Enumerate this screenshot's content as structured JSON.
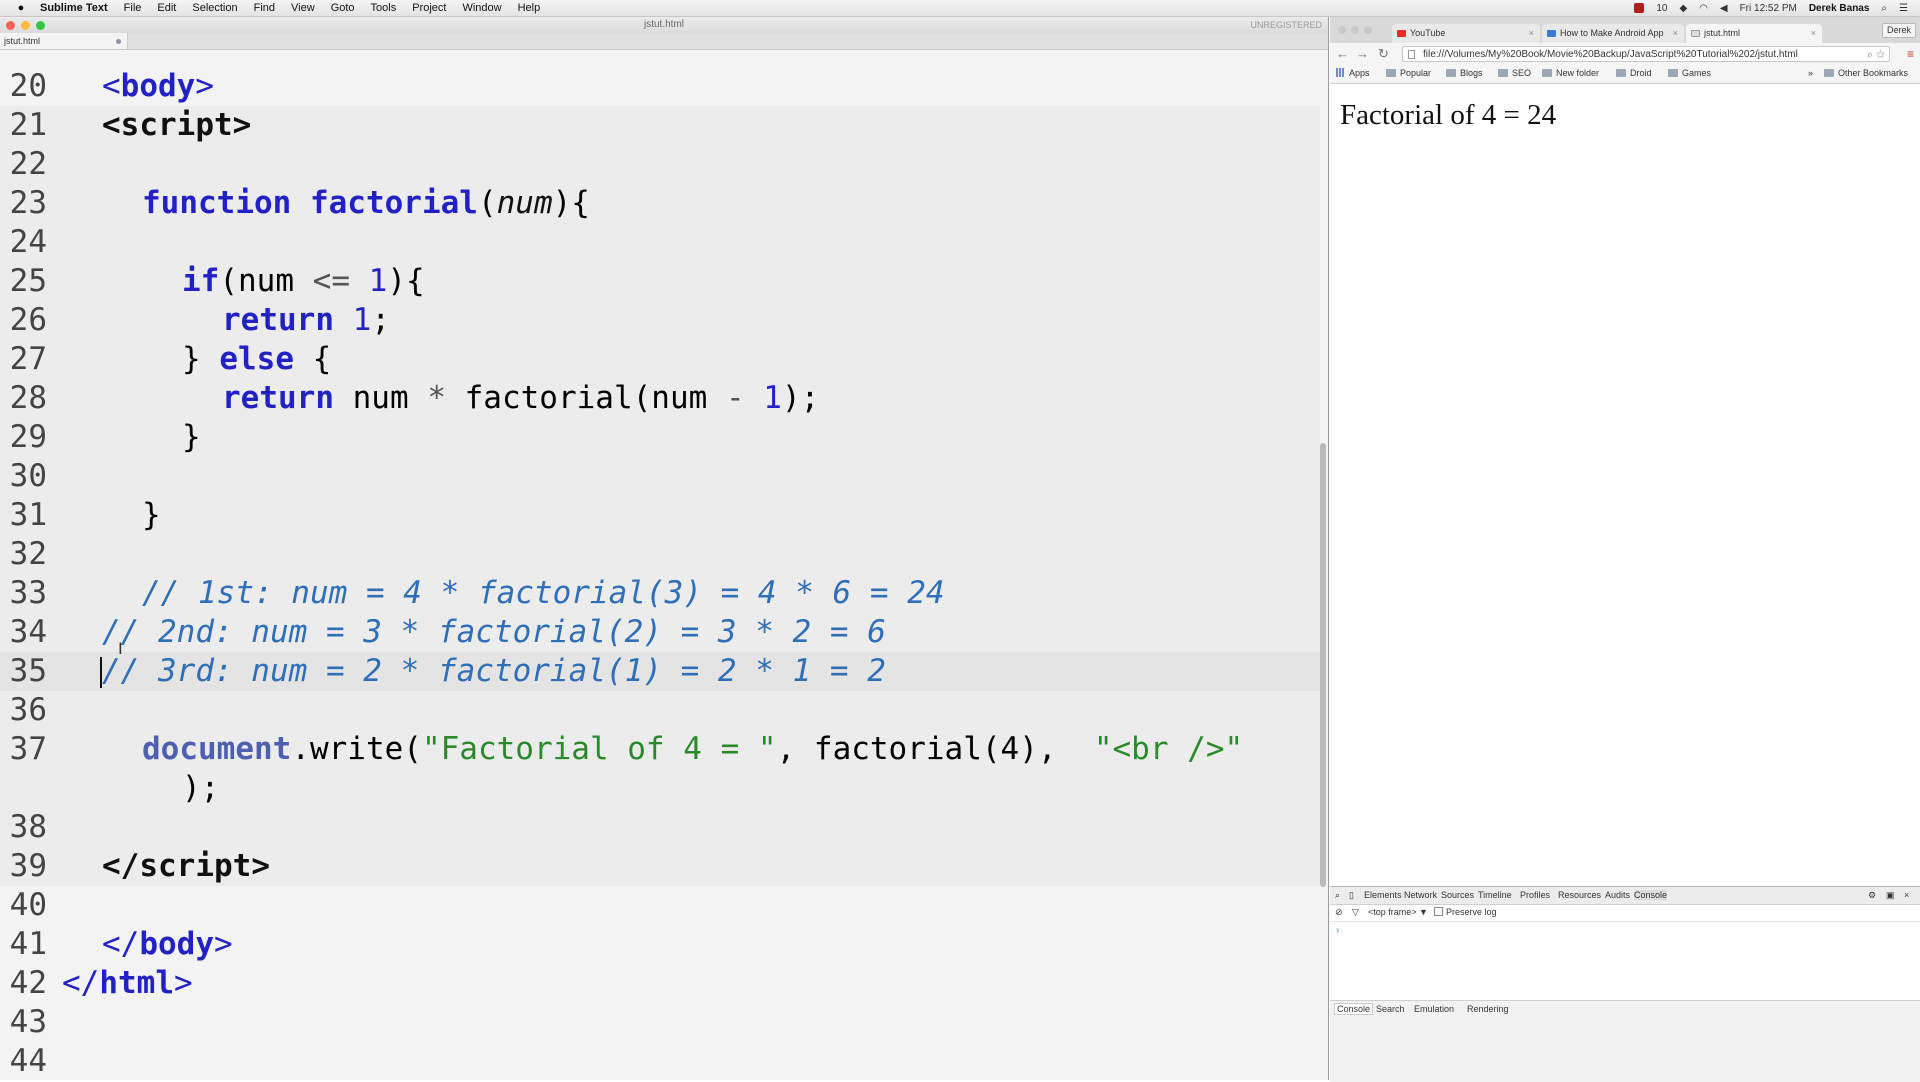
{
  "menubar": {
    "apple": "",
    "app_name": "Sublime Text",
    "items": [
      "File",
      "Edit",
      "Selection",
      "Find",
      "View",
      "Goto",
      "Tools",
      "Project",
      "Window",
      "Help"
    ],
    "tray_count": "10",
    "clock": "Fri 12:52 PM",
    "user": "Derek Banas"
  },
  "editor": {
    "window_title": "jstut.html",
    "unregistered": "UNREGISTERED",
    "tab_label": "jstut.html",
    "lines": [
      {
        "n": "20"
      },
      {
        "n": "21"
      },
      {
        "n": "22"
      },
      {
        "n": "23"
      },
      {
        "n": "24"
      },
      {
        "n": "25"
      },
      {
        "n": "26"
      },
      {
        "n": "27"
      },
      {
        "n": "28"
      },
      {
        "n": "29"
      },
      {
        "n": "30"
      },
      {
        "n": "31"
      },
      {
        "n": "32"
      },
      {
        "n": "33"
      },
      {
        "n": "34"
      },
      {
        "n": "35"
      },
      {
        "n": "36"
      },
      {
        "n": "37"
      },
      {
        "n": "38"
      },
      {
        "n": "39"
      },
      {
        "n": "40"
      },
      {
        "n": "41"
      },
      {
        "n": "42"
      },
      {
        "n": "43"
      },
      {
        "n": "44"
      }
    ],
    "code": {
      "l20_open": "<",
      "l20_tag": "body",
      "l20_close": ">",
      "l21_open": "<",
      "l21_tag": "script",
      "l21_close": ">",
      "l23_kw": "function",
      "l23_name": " factorial",
      "l23_paren_open": "(",
      "l23_arg": "num",
      "l23_paren_close": "){",
      "l25_kw": "if",
      "l25_rest_a": "(num ",
      "l25_op": "<=",
      "l25_sp": " ",
      "l25_num": "1",
      "l25_rest_b": "){",
      "l26_kw": "return",
      "l26_sp": " ",
      "l26_num": "1",
      "l26_end": ";",
      "l27_brace": "} ",
      "l27_kw": "else",
      "l27_end": " {",
      "l28_kw": "return",
      "l28_a": " num ",
      "l28_op1": "*",
      "l28_b": " factorial(num ",
      "l28_op2": "-",
      "l28_sp": " ",
      "l28_num": "1",
      "l28_end": ");",
      "l29": "}",
      "l31": "}",
      "l33": "// 1st: num = 4 * factorial(3) = 4 * 6 = 24",
      "l34": "// 2nd: num = 3 * factorial(2) = 3 * 2 = 6",
      "l35": "// 3rd: num = 2 * factorial(1) = 2 * 1 = 2",
      "l37_obj": "document",
      "l37_a": ".write(",
      "l37_str1": "\"Factorial of 4 = \"",
      "l37_b": ", factorial(4),  ",
      "l37_str2": "\"<br />\"",
      "l37_wrap": ");",
      "l39_open": "</",
      "l39_tag": "script",
      "l39_close": ">",
      "l41_open": "</",
      "l41_tag": "body",
      "l41_close": ">",
      "l42_open": "</",
      "l42_tag": "html",
      "l42_close": ">"
    }
  },
  "browser": {
    "tabs": [
      {
        "label": "YouTube",
        "close": "×"
      },
      {
        "label": "How to Make Android App",
        "close": "×"
      },
      {
        "label": "jstut.html",
        "close": "×"
      }
    ],
    "user_button": "Derek",
    "nav": {
      "back": "←",
      "forward": "→",
      "reload": "↻"
    },
    "address": "file:///Volumes/My%20Book/Movie%20Backup/JavaScript%20Tutorial%202/jstut.html",
    "bookmarks": [
      "Apps",
      "Popular",
      "Blogs",
      "SEO",
      "New folder",
      "Droid",
      "Games"
    ],
    "bookmarks_more": "»",
    "other_bookmarks": "Other Bookmarks",
    "page_text": "Factorial of 4 = 24",
    "devtools": {
      "tabs": [
        "Elements",
        "Network",
        "Sources",
        "Timeline",
        "Profiles",
        "Resources",
        "Audits",
        "Console"
      ],
      "frame": "<top frame>",
      "frame_arrow": "▼",
      "preserve_log": "Preserve log",
      "prompt": "›",
      "drawer_tabs": [
        "Console",
        "Search",
        "Emulation",
        "Rendering"
      ]
    }
  },
  "colors": {
    "keyword": "#2222c4",
    "comment": "#2f6fb7",
    "string": "#2a8a2a",
    "close_light": "#fc605b",
    "min_light": "#fdbc40",
    "max_light": "#34c84a"
  }
}
